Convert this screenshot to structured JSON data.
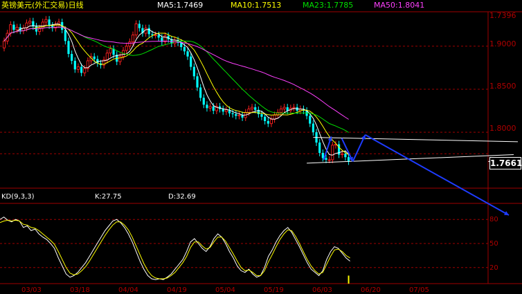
{
  "chart_title": "英镑美元(外汇交易)日线",
  "ma_legend": [
    {
      "label": "MA5:1.7469",
      "color": "#ffffff"
    },
    {
      "label": "MA10:1.7513",
      "color": "#ffff00"
    },
    {
      "label": "MA23:1.7785",
      "color": "#00e000"
    },
    {
      "label": "MA50:1.8041",
      "color": "#ff40ff"
    }
  ],
  "kd_legend": {
    "name": "KD(9,3,3)",
    "k": "K:27.75",
    "d": "D:32.69"
  },
  "last_price": "1.7661",
  "colors": {
    "up": "#ff2020",
    "down": "#00ffff",
    "grid": "#a00000",
    "axis_text": "#b00000",
    "k_line": "#ffffff",
    "d_line": "#ffff00"
  },
  "chart_data": [
    {
      "type": "candlestick",
      "name": "price",
      "ylim": [
        1.735,
        1.94
      ],
      "yticks": [
        "1.9000",
        "1.8500",
        "1.8000"
      ],
      "top_label": "1.7396",
      "current_label": "1.7661",
      "x_ticks": [
        "03/03",
        "03/18",
        "04/04",
        "04/19",
        "05/04",
        "05/19",
        "06/03",
        "06/20",
        "07/05"
      ],
      "x_tick_index": [
        2,
        17,
        32,
        47,
        62,
        77,
        92,
        107,
        122
      ],
      "close": [
        1.906,
        1.915,
        1.925,
        1.919,
        1.922,
        1.918,
        1.921,
        1.927,
        1.929,
        1.923,
        1.917,
        1.921,
        1.928,
        1.931,
        1.924,
        1.921,
        1.925,
        1.928,
        1.919,
        1.906,
        1.891,
        1.883,
        1.873,
        1.876,
        1.869,
        1.874,
        1.883,
        1.888,
        1.885,
        1.88,
        1.878,
        1.884,
        1.892,
        1.897,
        1.89,
        1.882,
        1.888,
        1.895,
        1.9,
        1.905,
        1.913,
        1.926,
        1.921,
        1.915,
        1.921,
        1.914,
        1.913,
        1.913,
        1.91,
        1.905,
        1.912,
        1.908,
        1.903,
        1.907,
        1.904,
        1.899,
        1.894,
        1.888,
        1.876,
        1.865,
        1.852,
        1.84,
        1.832,
        1.828,
        1.83,
        1.825,
        1.83,
        1.827,
        1.824,
        1.826,
        1.822,
        1.821,
        1.819,
        1.82,
        1.817,
        1.823,
        1.827,
        1.829,
        1.826,
        1.821,
        1.818,
        1.813,
        1.81,
        1.815,
        1.82,
        1.823,
        1.827,
        1.829,
        1.825,
        1.828,
        1.829,
        1.825,
        1.827,
        1.825,
        1.819,
        1.81,
        1.8,
        1.788,
        1.776,
        1.77,
        1.768,
        1.768,
        1.785,
        1.786,
        1.774,
        1.775,
        1.771,
        1.766
      ],
      "open": [
        1.898,
        1.906,
        1.915,
        1.925,
        1.919,
        1.922,
        1.918,
        1.921,
        1.927,
        1.929,
        1.923,
        1.917,
        1.921,
        1.928,
        1.931,
        1.924,
        1.921,
        1.925,
        1.928,
        1.919,
        1.906,
        1.891,
        1.883,
        1.873,
        1.876,
        1.869,
        1.874,
        1.883,
        1.888,
        1.885,
        1.88,
        1.878,
        1.884,
        1.892,
        1.897,
        1.89,
        1.882,
        1.888,
        1.895,
        1.9,
        1.905,
        1.913,
        1.926,
        1.921,
        1.915,
        1.921,
        1.914,
        1.913,
        1.913,
        1.91,
        1.905,
        1.912,
        1.908,
        1.903,
        1.907,
        1.904,
        1.899,
        1.894,
        1.888,
        1.876,
        1.865,
        1.852,
        1.84,
        1.832,
        1.828,
        1.83,
        1.825,
        1.83,
        1.827,
        1.824,
        1.826,
        1.822,
        1.821,
        1.819,
        1.82,
        1.817,
        1.823,
        1.827,
        1.829,
        1.826,
        1.821,
        1.818,
        1.813,
        1.81,
        1.815,
        1.82,
        1.823,
        1.827,
        1.829,
        1.825,
        1.828,
        1.829,
        1.825,
        1.827,
        1.825,
        1.819,
        1.81,
        1.8,
        1.788,
        1.776,
        1.77,
        1.768,
        1.768,
        1.785,
        1.786,
        1.774,
        1.775,
        1.771
      ],
      "moving_averages": [
        {
          "name": "MA5",
          "period": 5
        },
        {
          "name": "MA10",
          "period": 10
        },
        {
          "name": "MA23",
          "period": 23
        },
        {
          "name": "MA50",
          "period": 50
        }
      ]
    },
    {
      "type": "line",
      "name": "KD(9,3,3)",
      "ylim": [
        0,
        100
      ],
      "yticks": [
        "80",
        "50",
        "20"
      ],
      "series": [
        {
          "name": "K",
          "values": [
            80,
            83,
            79,
            77,
            80,
            78,
            70,
            72,
            66,
            68,
            62,
            58,
            55,
            50,
            44,
            32,
            22,
            12,
            8,
            10,
            14,
            20,
            26,
            34,
            42,
            50,
            58,
            66,
            72,
            78,
            80,
            76,
            70,
            62,
            52,
            40,
            28,
            18,
            10,
            6,
            5,
            6,
            5,
            8,
            12,
            18,
            24,
            30,
            40,
            52,
            56,
            50,
            44,
            40,
            46,
            56,
            62,
            58,
            50,
            40,
            32,
            22,
            16,
            14,
            18,
            12,
            8,
            10,
            20,
            34,
            42,
            52,
            60,
            66,
            70,
            64,
            55,
            46,
            36,
            26,
            18,
            14,
            10,
            16,
            30,
            40,
            46,
            44,
            38,
            32,
            28
          ]
        },
        {
          "name": "D",
          "values": [
            76,
            78,
            79,
            78,
            79,
            78,
            74,
            73,
            70,
            69,
            66,
            62,
            58,
            54,
            49,
            40,
            30,
            20,
            13,
            11,
            12,
            16,
            21,
            28,
            36,
            44,
            52,
            60,
            67,
            73,
            77,
            77,
            73,
            67,
            58,
            47,
            36,
            25,
            16,
            10,
            7,
            6,
            6,
            7,
            10,
            14,
            20,
            26,
            34,
            45,
            52,
            52,
            47,
            43,
            45,
            52,
            58,
            58,
            53,
            45,
            37,
            28,
            20,
            16,
            17,
            14,
            10,
            10,
            16,
            27,
            36,
            46,
            55,
            62,
            67,
            66,
            59,
            50,
            40,
            30,
            22,
            16,
            12,
            14,
            24,
            34,
            42,
            43,
            40,
            35,
            32
          ]
        }
      ]
    }
  ]
}
